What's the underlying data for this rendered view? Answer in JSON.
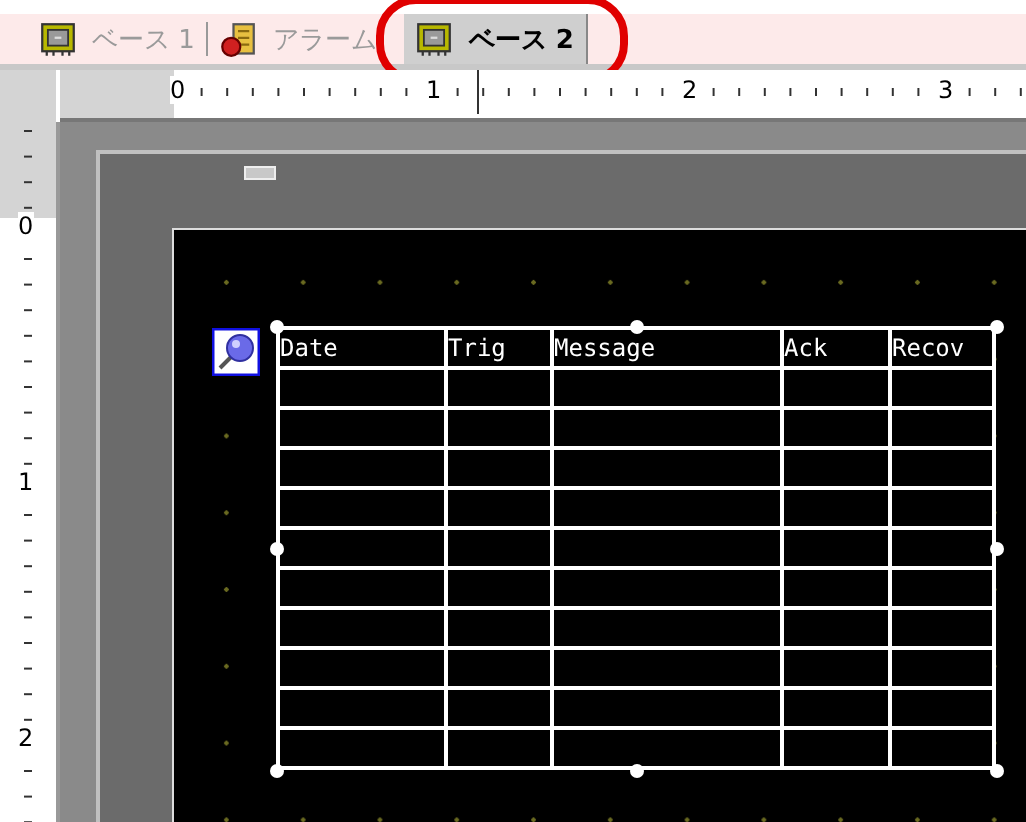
{
  "tabs": [
    {
      "label": "ベース 1",
      "kind": "screen",
      "selected": false,
      "circled": false
    },
    {
      "label": "アラーム",
      "kind": "alarm",
      "selected": false,
      "circled": false
    },
    {
      "label": "ベース 2",
      "kind": "screen",
      "selected": true,
      "circled": true
    }
  ],
  "ruler": {
    "horizontal_labels": [
      "0",
      "1",
      "2",
      "3"
    ],
    "vertical_labels": [
      "0",
      "1",
      "2"
    ]
  },
  "alarm_table": {
    "selected": true,
    "columns": [
      "Date",
      "Trig",
      "Message",
      "Ack",
      "Recov"
    ]
  }
}
